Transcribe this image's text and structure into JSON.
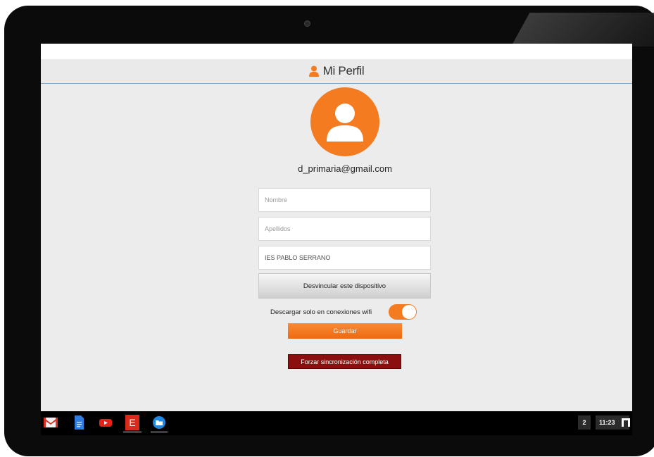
{
  "header": {
    "title": "Mi Perfil",
    "title_icon": "person-icon"
  },
  "profile": {
    "email": "d_primaria@gmail.com",
    "avatar_icon": "user-avatar-icon"
  },
  "form": {
    "nombre": {
      "placeholder": "Nombre",
      "value": ""
    },
    "apellidos": {
      "placeholder": "Apellidos",
      "value": ""
    },
    "centro": {
      "placeholder": "",
      "value": "IES PABLO SERRANO"
    }
  },
  "actions": {
    "unlink_label": "Desvincular este dispositivo",
    "wifi_label": "Descargar solo en conexiones wifi",
    "wifi_enabled": true,
    "save_label": "Guardar",
    "sync_label": "Forzar sincronización completa"
  },
  "taskbar": {
    "apps": [
      "gmail-icon",
      "docs-icon",
      "youtube-icon",
      "app-e-icon",
      "files-icon"
    ],
    "app_e_letter": "E",
    "notification_count": "2",
    "time": "11:23"
  },
  "colors": {
    "accent": "#f47b20",
    "danger": "#8c0f0f",
    "background": "#ececec"
  }
}
